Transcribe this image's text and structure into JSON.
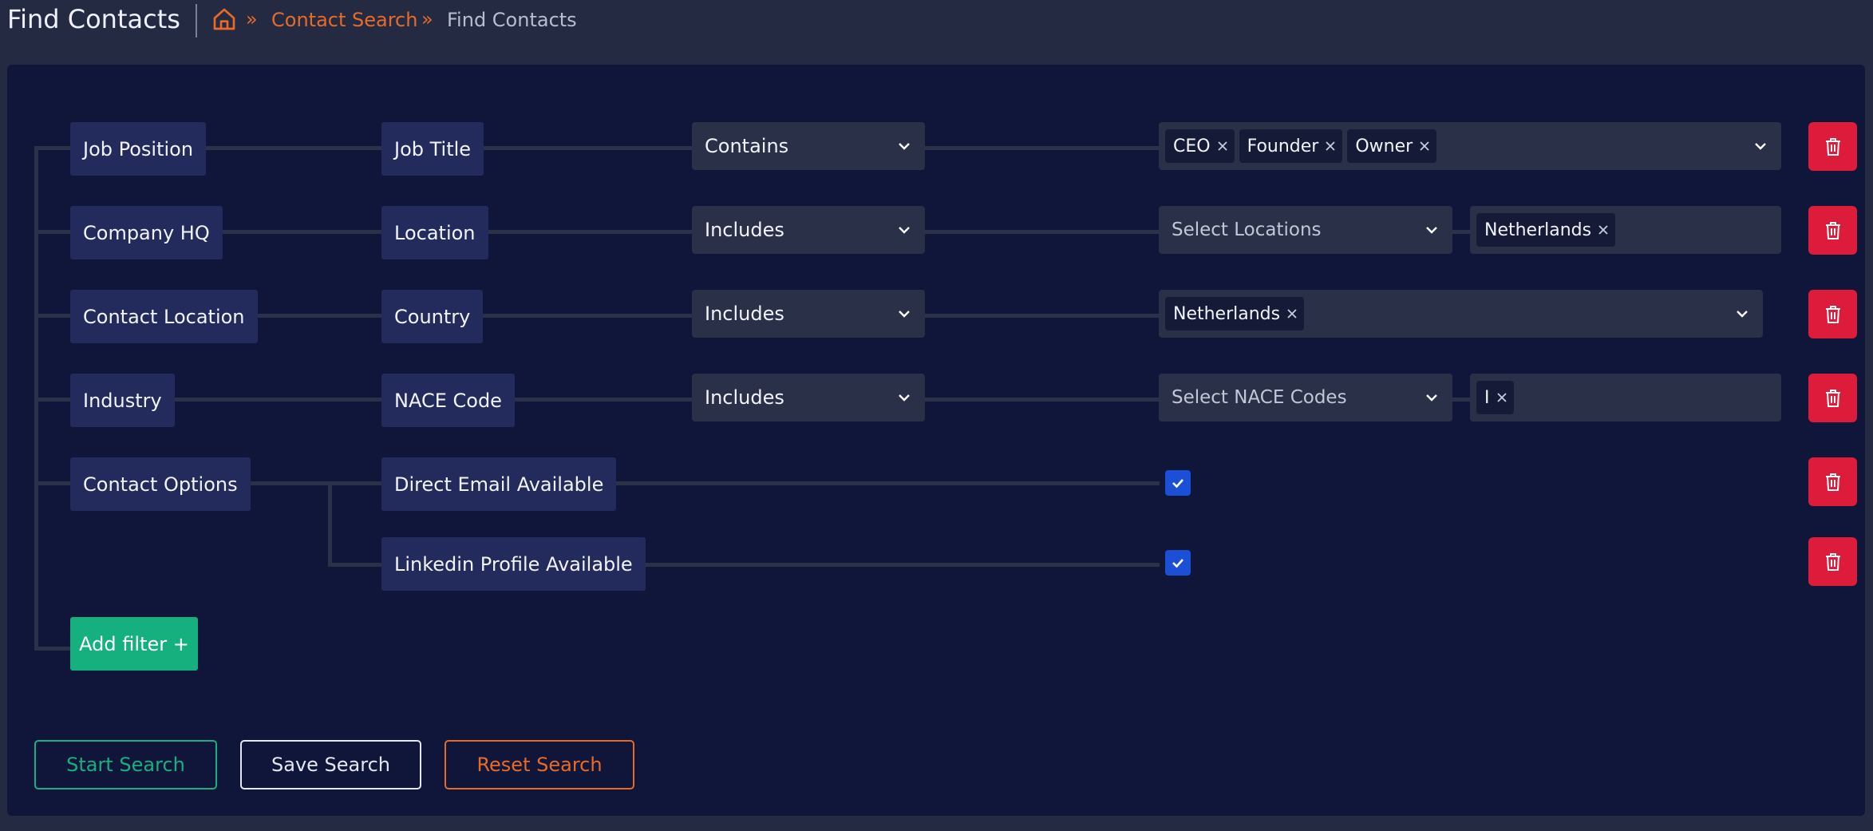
{
  "header": {
    "title": "Find Contacts",
    "breadcrumb": {
      "separator": "»",
      "link": "Contact Search",
      "current": "Find Contacts"
    }
  },
  "filters": [
    {
      "field": "Job Position",
      "subfield": "Job Title",
      "operator": "Contains",
      "tags": [
        "CEO",
        "Founder",
        "Owner"
      ]
    },
    {
      "field": "Company HQ",
      "subfield": "Location",
      "operator": "Includes",
      "placeholder": "Select Locations",
      "tags": [
        "Netherlands"
      ]
    },
    {
      "field": "Contact Location",
      "subfield": "Country",
      "operator": "Includes",
      "tags": [
        "Netherlands"
      ]
    },
    {
      "field": "Industry",
      "subfield": "NACE Code",
      "operator": "Includes",
      "placeholder": "Select NACE Codes",
      "tags": [
        "I"
      ]
    },
    {
      "field": "Contact Options",
      "options": [
        {
          "label": "Direct Email Available",
          "checked": true
        },
        {
          "label": "Linkedin Profile Available",
          "checked": true
        }
      ]
    }
  ],
  "add_filter_label": "Add filter +",
  "actions": {
    "start": "Start Search",
    "save": "Save Search",
    "reset": "Reset Search"
  },
  "colors": {
    "accent_orange": "#e76b27",
    "accent_green": "#16b07e",
    "danger_red": "#dd1b3b",
    "checkbox_blue": "#1a4fd6"
  },
  "icons": {
    "home": "home-icon",
    "chevron": "chevron-down-icon",
    "remove": "close-icon",
    "delete": "trash-icon",
    "check": "check-icon"
  }
}
